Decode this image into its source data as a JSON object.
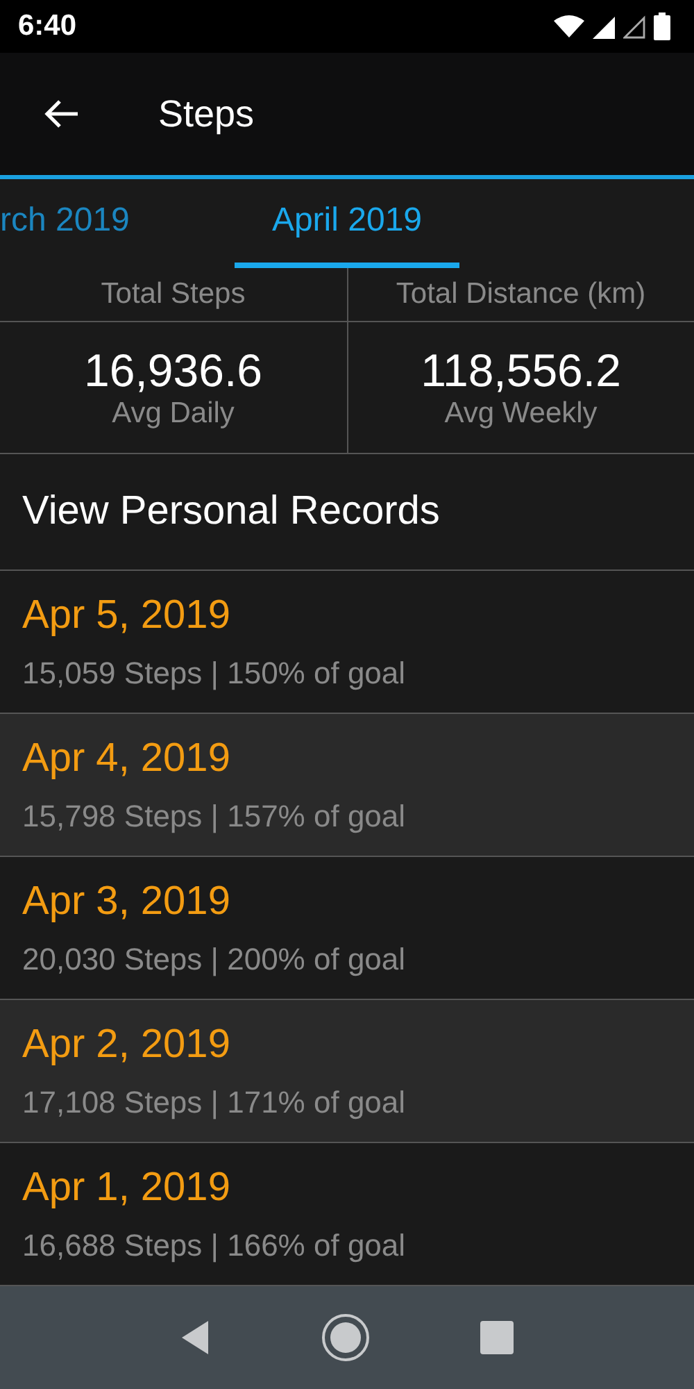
{
  "status_bar": {
    "time": "6:40"
  },
  "app_bar": {
    "title": "Steps"
  },
  "tabs": [
    {
      "label": "rch 2019",
      "selected": false
    },
    {
      "label": "April 2019",
      "selected": true
    }
  ],
  "summary": [
    {
      "heading": "Total Steps",
      "value": "16,936.6",
      "caption": "Avg Daily"
    },
    {
      "heading": "Total Distance (km)",
      "value": "118,556.2",
      "caption": "Avg Weekly"
    }
  ],
  "records_link": "View Personal Records",
  "days": [
    {
      "date": "Apr 5, 2019",
      "detail": "15,059 Steps | 150% of goal"
    },
    {
      "date": "Apr 4, 2019",
      "detail": "15,798 Steps | 157% of goal"
    },
    {
      "date": "Apr 3, 2019",
      "detail": "20,030 Steps | 200% of goal"
    },
    {
      "date": "Apr 2, 2019",
      "detail": "17,108 Steps | 171% of goal"
    },
    {
      "date": "Apr 1, 2019",
      "detail": "16,688 Steps | 166% of goal"
    }
  ]
}
